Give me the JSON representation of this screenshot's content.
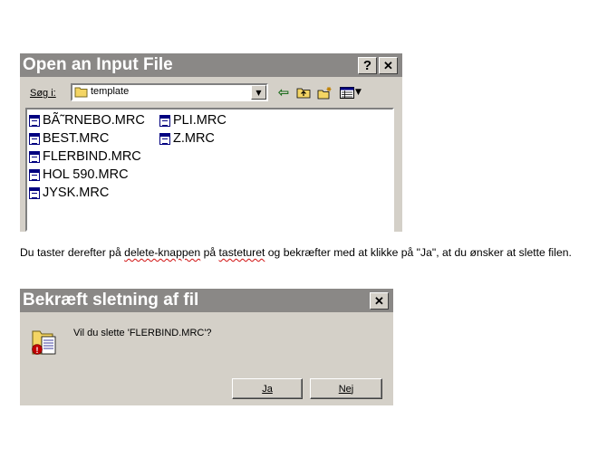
{
  "open_dialog": {
    "title": "Open an Input File",
    "help_button": "?",
    "close_button": "✕",
    "look_in_label": "Søg i:",
    "look_in_value": "template",
    "toolbar": {
      "back_icon": "⇦",
      "up_folder_icon": "up-one-level",
      "new_folder_icon": "create-new-folder",
      "view_menu_icon": "view-menu"
    },
    "files_col1": [
      "BÃ˜RNEBO.MRC",
      "BEST.MRC",
      "FLERBIND.MRC",
      "HOL 590.MRC",
      "JYSK.MRC"
    ],
    "files_col2": [
      "PLI.MRC",
      "Z.MRC"
    ]
  },
  "instruction": {
    "text_1": "Du taster derefter på ",
    "link_delete": "delete-knappen",
    "text_2": " på ",
    "link_keyboard": "tasteturet",
    "text_3": " og bekræfter med at klikke på \"Ja\", at du ønsker at slette filen."
  },
  "confirm_dialog": {
    "title": "Bekræft sletning af fil",
    "close_button": "✕",
    "message": "Vil du slette 'FLERBIND.MRC'?",
    "yes_button": "Ja",
    "no_button": "Nej"
  },
  "colors": {
    "titlebar_inactive": "#8a8886",
    "dialog_face": "#d4d0c8",
    "folder_yellow": "#f4d564"
  }
}
